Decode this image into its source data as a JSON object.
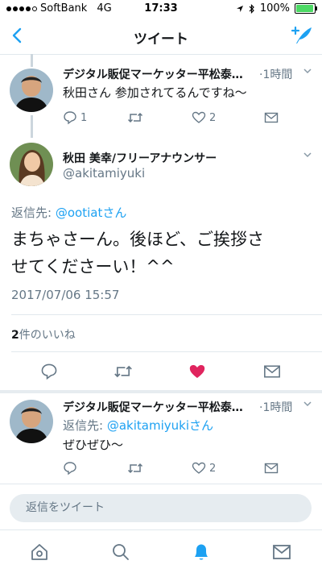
{
  "status": {
    "carrier": "SoftBank",
    "network": "4G",
    "time": "17:33",
    "battery_text": "100%",
    "battery_level": 1.0
  },
  "nav": {
    "title": "ツイート"
  },
  "tweets": [
    {
      "author": "デジタル販促マーケッター平松泰…",
      "time": "1時間",
      "text": "秋田さん 参加されてるんですね〜",
      "reply_count": "1",
      "like_count": "2"
    },
    {
      "author": "デジタル販促マーケッター平松泰…",
      "time": "1時間",
      "reply_prefix": "返信先:",
      "reply_handle": "@akitamiyukiさん",
      "text": "ぜひぜひ〜",
      "like_count": "2"
    }
  ],
  "main": {
    "name": "秋田 美幸/フリーアナウンサー",
    "handle": "@akitamiyuki",
    "reply_prefix": "返信先:",
    "reply_handle": "@ootiatさん",
    "text_line1": "まちゃさーん。後ほど、ご挨拶さ",
    "text_line2": "せてくださーい！^^",
    "timestamp": "2017/07/06 15:57",
    "likes_count": "2",
    "likes_label": "件のいいね"
  },
  "reply_bar": {
    "placeholder": "返信をツイート"
  },
  "tabbar": {
    "items": [
      "home-icon",
      "search-icon",
      "notifications-icon",
      "messages-icon"
    ],
    "active_index": 2
  },
  "colors": {
    "accent": "#1da1f2",
    "like": "#e0245e",
    "muted": "#657786"
  }
}
